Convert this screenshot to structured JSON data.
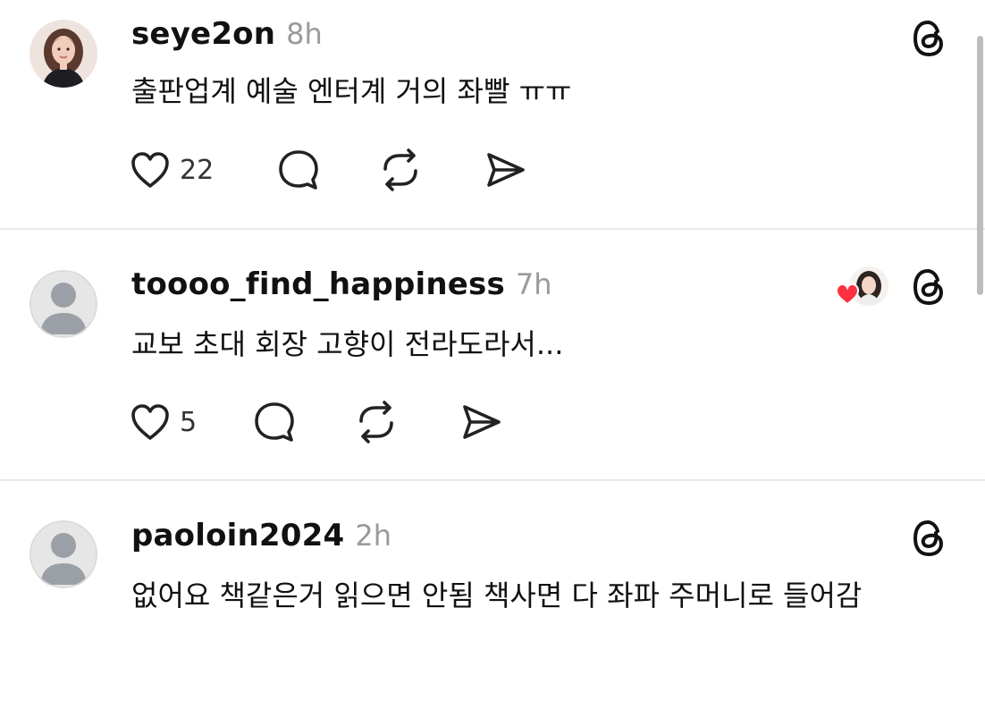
{
  "posts": [
    {
      "username": "seye2on",
      "time": "8h",
      "text": "출판업계 예술 엔터계 거의 좌빨 ㅠㅠ",
      "likes": "22",
      "avatar": "profile-photo"
    },
    {
      "username": "toooo_find_happiness",
      "time": "7h",
      "text": "교보 초대 회장 고향이 전라도라서...",
      "likes": "5",
      "avatar": "default-avatar",
      "liked_by_author": true
    },
    {
      "username": "paoloin2024",
      "time": "2h",
      "text": "없어요 책같은거 읽으면 안됨 책사면 다 좌파 주머니로 들어감",
      "avatar": "default-avatar"
    }
  ],
  "icons": {
    "like": "heart-outline-icon",
    "reply": "comment-bubble-icon",
    "repost": "repost-arrows-icon",
    "share": "send-paper-plane-icon",
    "threads": "threads-logo-icon"
  },
  "colors": {
    "text": "#111111",
    "muted": "#9a9a9a",
    "heart": "#ff3040",
    "divider": "#e8e8e8"
  }
}
